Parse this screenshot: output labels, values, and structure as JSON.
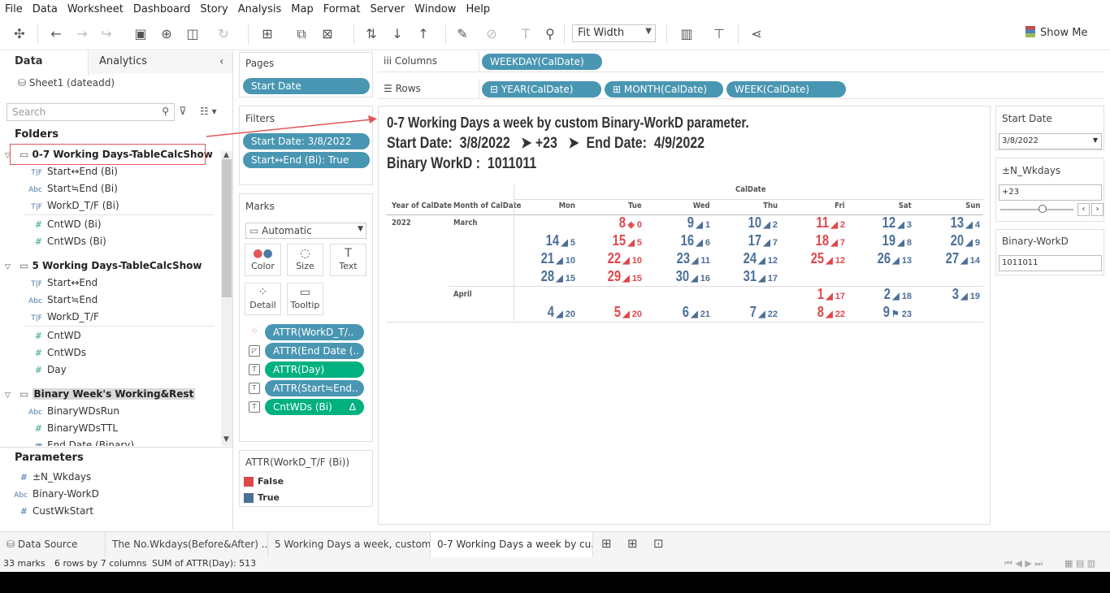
{
  "menu": [
    "File",
    "Data",
    "Worksheet",
    "Dashboard",
    "Story",
    "Analysis",
    "Map",
    "Format",
    "Server",
    "Window",
    "Help"
  ],
  "toolbar": {
    "fit": "Fit Width",
    "show_me": "Show Me"
  },
  "left": {
    "tab_data": "Data",
    "tab_analytics": "Analytics",
    "source": "Sheet1 (dateadd)",
    "search_placeholder": "Search",
    "folders_label": "Folders",
    "folder1": "0-7 Working Days-TableCalcShow",
    "f1": [
      {
        "t": "T|F",
        "n": "Start↔End (Bi)"
      },
      {
        "t": "Abc",
        "n": "Start≒End (Bi)"
      },
      {
        "t": "T|F",
        "n": "WorkD_T/F (Bi)"
      },
      {
        "t": "#",
        "n": "CntWD (Bi)"
      },
      {
        "t": "#",
        "n": "CntWDs (Bi)"
      }
    ],
    "folder2": "5 Working Days-TableCalcShow",
    "f2": [
      {
        "t": "T|F",
        "n": "Start↔End"
      },
      {
        "t": "Abc",
        "n": "Start≒End"
      },
      {
        "t": "T|F",
        "n": "WorkD_T/F"
      },
      {
        "t": "#",
        "n": "CntWD"
      },
      {
        "t": "#",
        "n": "CntWDs"
      },
      {
        "t": "#",
        "n": "Day"
      }
    ],
    "folder3": "Binary Week's Working&Rest",
    "f3": [
      {
        "t": "Abc",
        "n": "BinaryWDsRun"
      },
      {
        "t": "#",
        "n": "BinaryWDsTTL"
      },
      {
        "t": "▦",
        "n": "End Date (Binary)"
      }
    ],
    "params_label": "Parameters",
    "params": [
      {
        "t": "#",
        "n": "±N_Wkdays"
      },
      {
        "t": "Abc",
        "n": "Binary-WorkD"
      },
      {
        "t": "#",
        "n": "CustWkStart"
      }
    ]
  },
  "pages": {
    "label": "Pages",
    "pill": "Start Date"
  },
  "filters": {
    "label": "Filters",
    "pills": [
      "Start Date: 3/8/2022",
      "Start↔End (Bi): True"
    ]
  },
  "marks": {
    "label": "Marks",
    "type": "Automatic",
    "buttons": [
      "Color",
      "Size",
      "Text",
      "Detail",
      "Tooltip"
    ],
    "pills": [
      "ATTR(WorkD_T/..",
      "ATTR(End Date (..",
      "ATTR(Day)",
      "ATTR(Start≒End..",
      "CntWDs (Bi)"
    ],
    "delta": "Δ"
  },
  "legend": {
    "title": "ATTR(WorkD_T/F (Bi))",
    "items": [
      {
        "label": "False",
        "color": "#e0474c"
      },
      {
        "label": "True",
        "color": "#4c6f98"
      }
    ]
  },
  "shelves": {
    "columns_label": "Columns",
    "rows_label": "Rows",
    "columns": [
      "WEEKDAY(CalDate)"
    ],
    "rows": [
      "⊟ YEAR(CalDate)",
      "⊞ MONTH(CalDate)",
      "WEEK(CalDate)"
    ]
  },
  "view": {
    "title1": "0-7 Working Days a week by custom Binary-WorkD parameter.",
    "t2a": "Start Date:",
    "t2b": "3/8/2022",
    "t2c": "➤",
    "t2d": "+23",
    "t2e": "➤",
    "t2f": "End Date:",
    "t2g": "4/9/2022",
    "t3a": "Binary WorkD :",
    "t3b": "1011011",
    "caldate": "CalDate",
    "year_hdr": "Year of CalDate",
    "month_hdr": "Month of CalDate",
    "days": [
      "Mon",
      "Tue",
      "Wed",
      "Thu",
      "Fri",
      "Sat",
      "Sun"
    ],
    "year": "2022",
    "months": [
      "March",
      "April"
    ],
    "cells": [
      {
        "r": 0,
        "c": 1,
        "d": "8",
        "s": "◈ 0",
        "w": "F"
      },
      {
        "r": 0,
        "c": 2,
        "d": "9",
        "s": "◢ 1",
        "w": "T"
      },
      {
        "r": 0,
        "c": 3,
        "d": "10",
        "s": "◢ 2",
        "w": "T"
      },
      {
        "r": 0,
        "c": 4,
        "d": "11",
        "s": "◢ 2",
        "w": "F"
      },
      {
        "r": 0,
        "c": 5,
        "d": "12",
        "s": "◢ 3",
        "w": "T"
      },
      {
        "r": 0,
        "c": 6,
        "d": "13",
        "s": "◢ 4",
        "w": "T"
      },
      {
        "r": 1,
        "c": 0,
        "d": "14",
        "s": "◢ 5",
        "w": "T"
      },
      {
        "r": 1,
        "c": 1,
        "d": "15",
        "s": "◢ 5",
        "w": "F"
      },
      {
        "r": 1,
        "c": 2,
        "d": "16",
        "s": "◢ 6",
        "w": "T"
      },
      {
        "r": 1,
        "c": 3,
        "d": "17",
        "s": "◢ 7",
        "w": "T"
      },
      {
        "r": 1,
        "c": 4,
        "d": "18",
        "s": "◢ 7",
        "w": "F"
      },
      {
        "r": 1,
        "c": 5,
        "d": "19",
        "s": "◢ 8",
        "w": "T"
      },
      {
        "r": 1,
        "c": 6,
        "d": "20",
        "s": "◢ 9",
        "w": "T"
      },
      {
        "r": 2,
        "c": 0,
        "d": "21",
        "s": "◢ 10",
        "w": "T"
      },
      {
        "r": 2,
        "c": 1,
        "d": "22",
        "s": "◢ 10",
        "w": "F"
      },
      {
        "r": 2,
        "c": 2,
        "d": "23",
        "s": "◢ 11",
        "w": "T"
      },
      {
        "r": 2,
        "c": 3,
        "d": "24",
        "s": "◢ 12",
        "w": "T"
      },
      {
        "r": 2,
        "c": 4,
        "d": "25",
        "s": "◢ 12",
        "w": "F"
      },
      {
        "r": 2,
        "c": 5,
        "d": "26",
        "s": "◢ 13",
        "w": "T"
      },
      {
        "r": 2,
        "c": 6,
        "d": "27",
        "s": "◢ 14",
        "w": "T"
      },
      {
        "r": 3,
        "c": 0,
        "d": "28",
        "s": "◢ 15",
        "w": "T"
      },
      {
        "r": 3,
        "c": 1,
        "d": "29",
        "s": "◢ 15",
        "w": "F"
      },
      {
        "r": 3,
        "c": 2,
        "d": "30",
        "s": "◢ 16",
        "w": "T"
      },
      {
        "r": 3,
        "c": 3,
        "d": "31",
        "s": "◢ 17",
        "w": "T"
      },
      {
        "r": 4,
        "c": 4,
        "d": "1",
        "s": "◢ 17",
        "w": "F"
      },
      {
        "r": 4,
        "c": 5,
        "d": "2",
        "s": "◢ 18",
        "w": "T"
      },
      {
        "r": 4,
        "c": 6,
        "d": "3",
        "s": "◢ 19",
        "w": "T"
      },
      {
        "r": 5,
        "c": 0,
        "d": "4",
        "s": "◢ 20",
        "w": "T"
      },
      {
        "r": 5,
        "c": 1,
        "d": "5",
        "s": "◢ 20",
        "w": "F"
      },
      {
        "r": 5,
        "c": 2,
        "d": "6",
        "s": "◢ 21",
        "w": "T"
      },
      {
        "r": 5,
        "c": 3,
        "d": "7",
        "s": "◢ 22",
        "w": "T"
      },
      {
        "r": 5,
        "c": 4,
        "d": "8",
        "s": "◢ 22",
        "w": "F"
      },
      {
        "r": 5,
        "c": 5,
        "d": "9",
        "s": "⚑ 23",
        "w": "T"
      }
    ]
  },
  "params_panel": {
    "start_label": "Start Date",
    "start_value": "3/8/2022",
    "nwk_label": "±N_Wkdays",
    "nwk_value": "+23",
    "bin_label": "Binary-WorkD",
    "bin_value": "1011011"
  },
  "sheets": {
    "source": "Data Source",
    "tabs": [
      "The No.Wkdays(Before&After)  ...",
      "5 Working Days a week, custom ...",
      "0-7 Working Days a week by cu..."
    ]
  },
  "status": {
    "marks": "33 marks",
    "rows": "6 rows by 7 columns",
    "sum": "SUM of ATTR(Day): 513"
  }
}
